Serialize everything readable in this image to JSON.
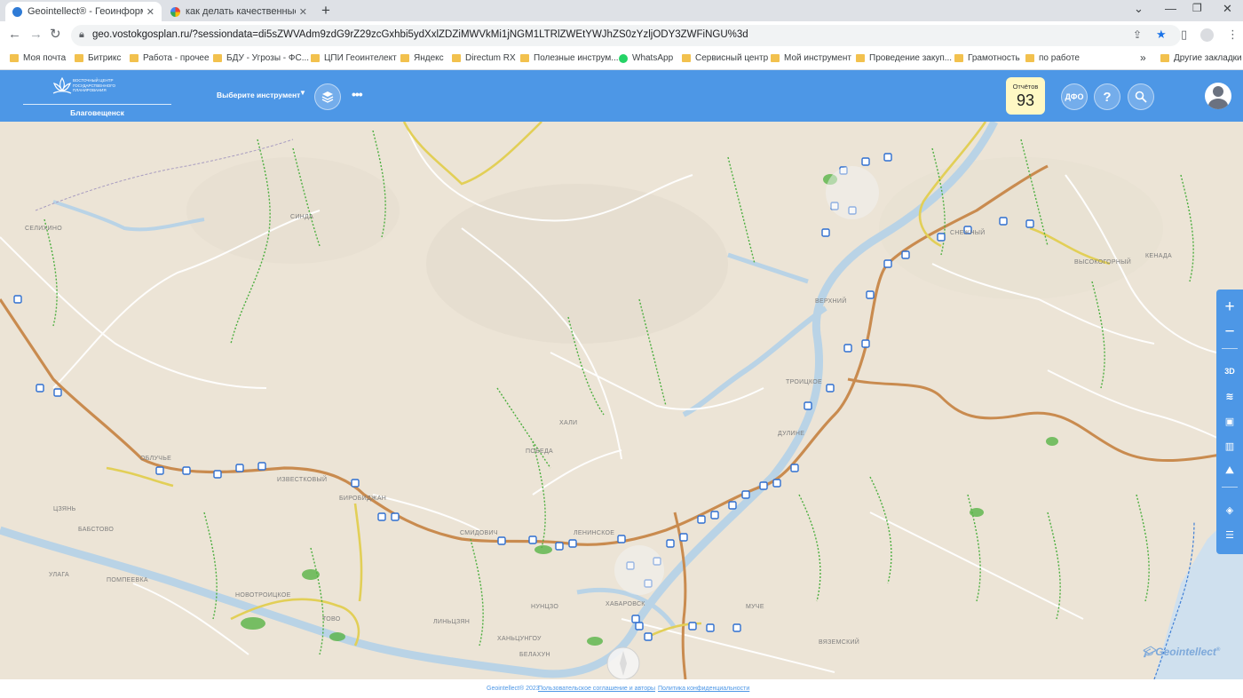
{
  "browser": {
    "tabs": [
      {
        "title": "Geointellect® - Геоинформаци",
        "active": true
      },
      {
        "title": "как делать качественные сним",
        "active": false
      }
    ],
    "url": "geo.vostokgosplan.ru/?sessiondata=di5sZWVAdm9zdG9rZ29zcGxhbi5ydXxlZDZiMWVkMi1jNGM1LTRlZWEtYWJhZS0zYzljODY3ZWFiNGU%3d",
    "bookmarks": [
      {
        "label": "Моя почта",
        "icon": "folder"
      },
      {
        "label": "Битрикс",
        "icon": "folder"
      },
      {
        "label": "Работа - прочее",
        "icon": "folder"
      },
      {
        "label": "БДУ - Угрозы - ФС...",
        "icon": "folder"
      },
      {
        "label": "ЦПИ Геоинтелект",
        "icon": "folder"
      },
      {
        "label": "Яндекс",
        "icon": "folder"
      },
      {
        "label": "Directum RX",
        "icon": "folder"
      },
      {
        "label": "Полезные инструм...",
        "icon": "folder"
      },
      {
        "label": "WhatsApp",
        "icon": "whatsapp"
      },
      {
        "label": "Сервисный центр",
        "icon": "folder"
      },
      {
        "label": "Мой инструмент",
        "icon": "folder"
      },
      {
        "label": "Проведение закуп...",
        "icon": "folder"
      },
      {
        "label": "Грамотность",
        "icon": "folder"
      },
      {
        "label": "по работе",
        "icon": "folder"
      }
    ],
    "overflow_label": "»",
    "other_bookmarks": "Другие закладки"
  },
  "app": {
    "logo_text_lines": [
      "ВОСТОЧНЫЙ ЦЕНТР",
      "ГОСУДАРСТВЕННОГО",
      "ПЛАНИРОВАНИЯ"
    ],
    "city": "Благовещенск",
    "tool_select": "Выберите инструмент",
    "reports_label": "Отчётов",
    "reports_count": "93",
    "dfo_label": "ДФО",
    "help_label": "?",
    "brand_color": "#4d97e6"
  },
  "map": {
    "labels": [
      "ЦЗЯНЬ",
      "ОБЛУЧЬЕ",
      "БИРОБИДЖАН",
      "СМИДОВИЧ",
      "ЛЕНИНСКОЕ",
      "ХАБАРОВСК",
      "ВЫСОКОГОРНЫЙ",
      "ДУЛИНЕ",
      "ХАЛИ",
      "ПОБЕДА",
      "НУНЦЗО",
      "ЛИНЬЦЗЯН",
      "ХАНЬЦУНГОУ",
      "БЕЛАХУН",
      "НОВОТРОИЦКОЕ",
      "ПОМПЕЕВКА",
      "ИЗВЕСТКОВЫЙ",
      "УЛАГА",
      "БАБСТОВО",
      "ТОВО",
      "СЕЛИХИНО",
      "ВЕРХНИЙ",
      "ТРОИЦКОЕ",
      "СИНДА",
      "КЕНАДА",
      "СНЕЖНЫЙ",
      "МУЧЕ",
      "ВЯЗЕМСКИЙ"
    ],
    "watermark": "Geointellect"
  },
  "right_toolbar": [
    "+",
    "−",
    "3D"
  ],
  "footer": {
    "copyright": "Geointellect® 2023",
    "agreement": "Пользовательское соглашение и авторы",
    "privacy": "Политика конфиденциальности"
  }
}
